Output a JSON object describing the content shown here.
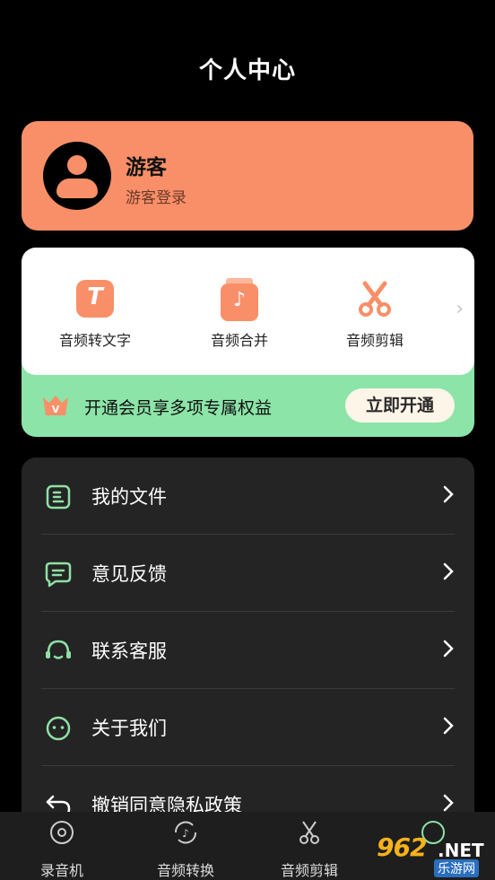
{
  "header": {
    "title": "个人中心"
  },
  "profile": {
    "name": "游客",
    "subtitle": "游客登录"
  },
  "tools": [
    {
      "label": "音频转文字",
      "icon": "text-transcribe-icon"
    },
    {
      "label": "音频合并",
      "icon": "audio-merge-icon"
    },
    {
      "label": "音频剪辑",
      "icon": "scissors-icon"
    }
  ],
  "vip": {
    "text": "开通会员享多项专属权益",
    "button": "立即开通",
    "icon": "crown-vip-icon"
  },
  "menu": [
    {
      "label": "我的文件",
      "icon": "file-icon"
    },
    {
      "label": "意见反馈",
      "icon": "feedback-icon"
    },
    {
      "label": "联系客服",
      "icon": "headset-icon"
    },
    {
      "label": "关于我们",
      "icon": "smiley-icon"
    },
    {
      "label": "撤销同意隐私政策",
      "icon": "undo-icon"
    }
  ],
  "bottom_nav": [
    {
      "label": "录音机",
      "icon": "record-icon"
    },
    {
      "label": "音频转换",
      "icon": "convert-icon"
    },
    {
      "label": "音频剪辑",
      "icon": "scissors-icon"
    },
    {
      "label": "",
      "icon": "profile-icon"
    }
  ],
  "watermark": {
    "number": "962",
    "domain": ".NET",
    "sub": "乐游网"
  },
  "colors": {
    "accent": "#f98f68",
    "vip_green": "#8ce4a8",
    "menu_bg": "#242424",
    "icon_green": "#8fe0a6"
  }
}
